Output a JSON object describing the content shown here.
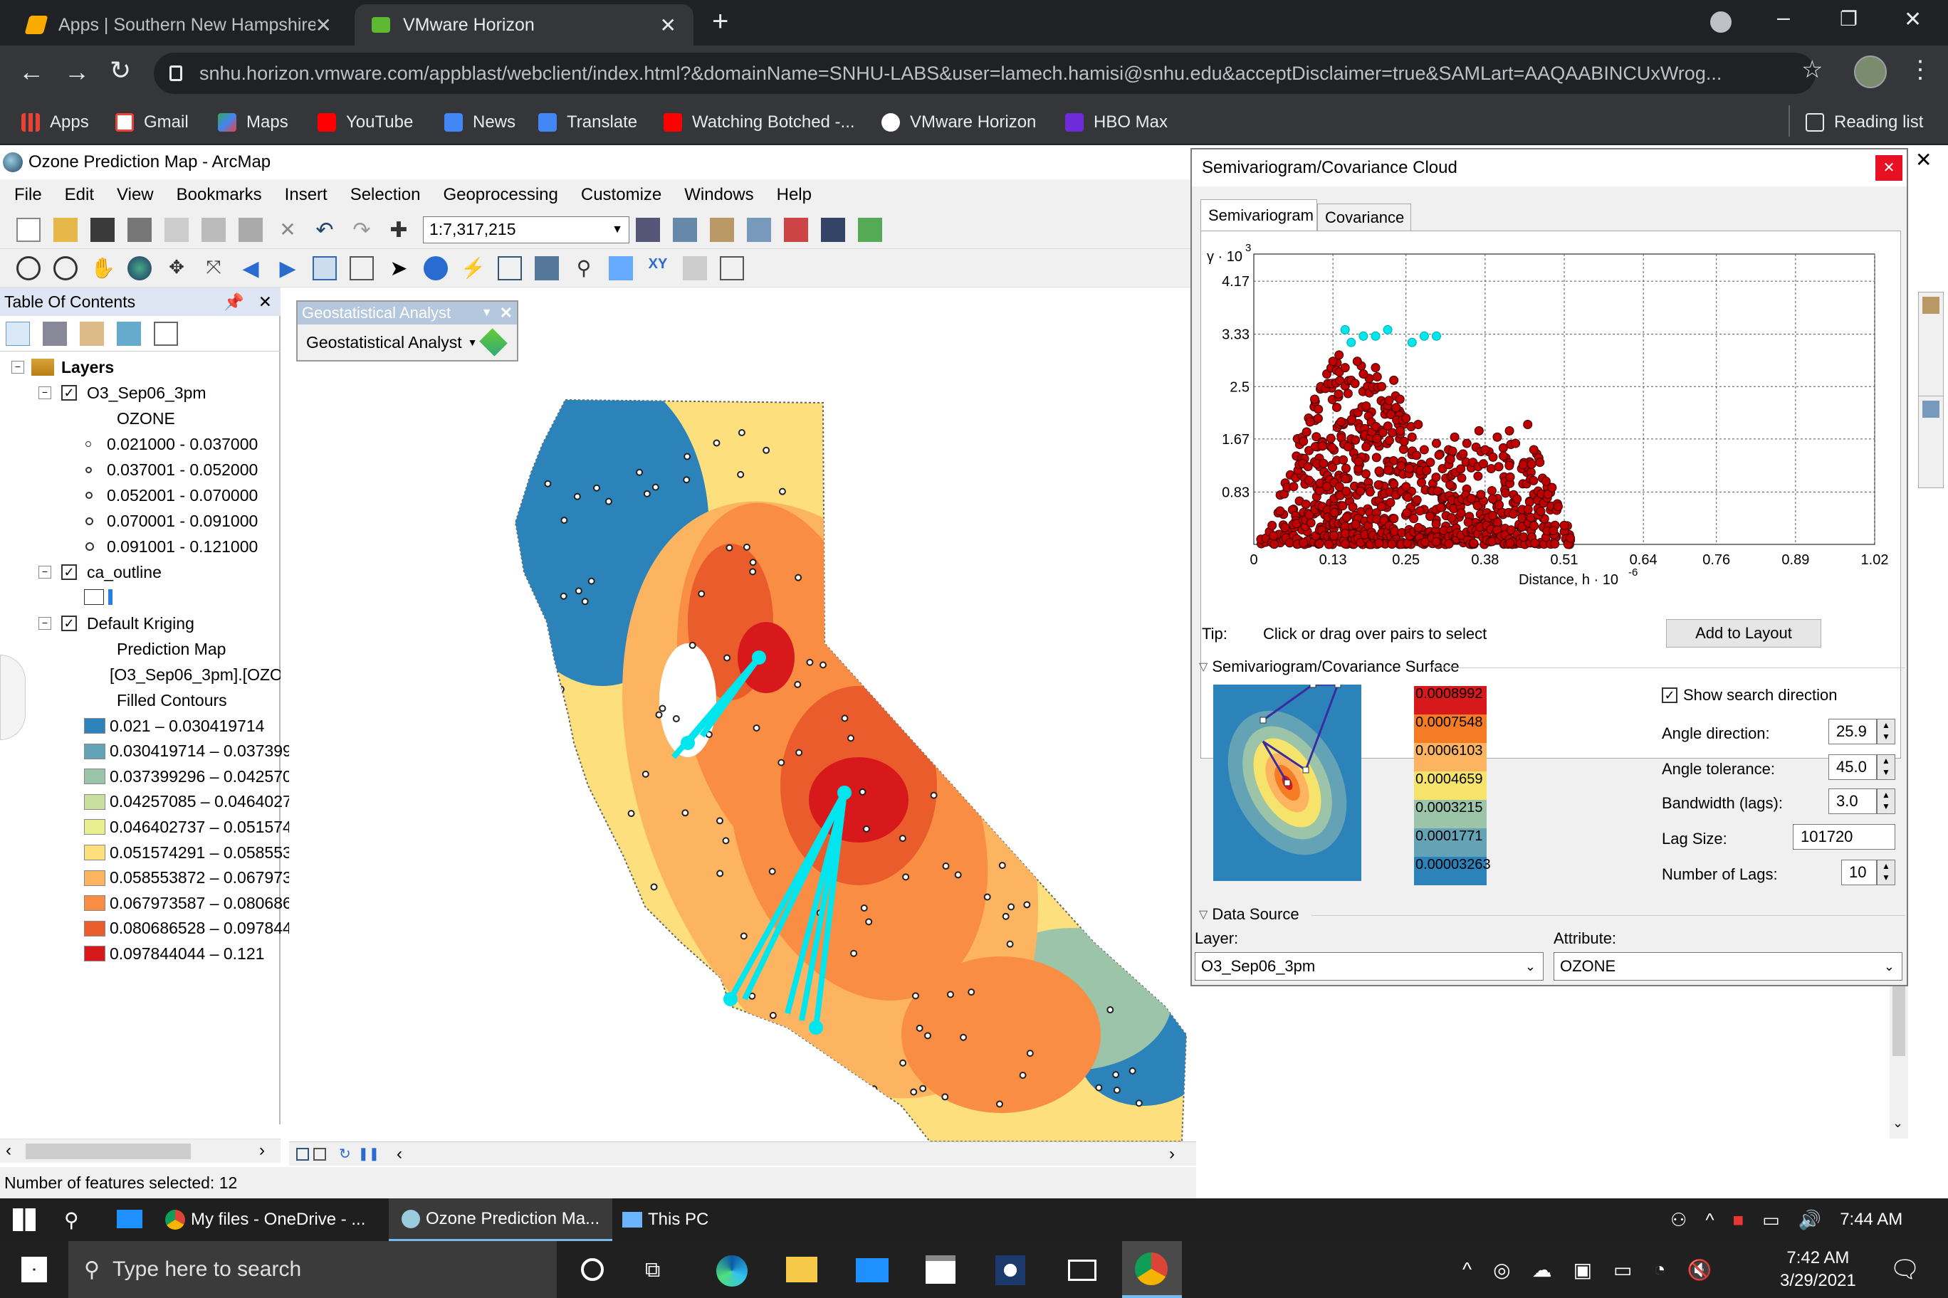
{
  "browser": {
    "tabs": [
      {
        "title": "Apps | Southern New Hampshire"
      },
      {
        "title": "VMware Horizon"
      }
    ],
    "url": "snhu.horizon.vmware.com/appblast/webclient/index.html?&domainName=SNHU-LABS&user=lamech.hamisi@snhu.edu&acceptDisclaimer=true&SAMLart=AAQAABINCUxWrog...",
    "bookmarks": [
      "Apps",
      "Gmail",
      "Maps",
      "YouTube",
      "News",
      "Translate",
      "Watching Botched -...",
      "VMware Horizon",
      "HBO Max"
    ],
    "reading_list": "Reading list"
  },
  "arcmap": {
    "title": "Ozone Prediction Map - ArcMap",
    "menus": [
      "File",
      "Edit",
      "View",
      "Bookmarks",
      "Insert",
      "Selection",
      "Geoprocessing",
      "Customize",
      "Windows",
      "Help"
    ],
    "scale": "1:7,317,215",
    "geo_toolbar_title": "Geostatistical Analyst",
    "geo_toolbar_button": "Geostatistical Analyst",
    "toc": {
      "title": "Table Of Contents",
      "layers_label": "Layers",
      "layer1": "O3_Sep06_3pm",
      "layer1_field": "OZONE",
      "layer1_classes": [
        "0.021000 - 0.037000",
        "0.037001 - 0.052000",
        "0.052001 - 0.070000",
        "0.070001 - 0.091000",
        "0.091001 - 0.121000"
      ],
      "layer2": "ca_outline",
      "layer3": "Default Kriging",
      "layer3_sub1": "Prediction Map",
      "layer3_sub2": "[O3_Sep06_3pm].[OZO",
      "layer3_sub3": "Filled Contours",
      "contours": [
        {
          "label": "0.021 – 0.030419714",
          "color": "#2b83ba"
        },
        {
          "label": "0.030419714 – 0.037399",
          "color": "#64a3b5"
        },
        {
          "label": "0.037399296 – 0.042570",
          "color": "#9cc4a8"
        },
        {
          "label": "0.04257085 – 0.0464027",
          "color": "#c7df9f"
        },
        {
          "label": "0.046402737 – 0.051574",
          "color": "#e9ee8e"
        },
        {
          "label": "0.051574291 – 0.058553",
          "color": "#fde07d"
        },
        {
          "label": "0.058553872 – 0.067973",
          "color": "#fdb460"
        },
        {
          "label": "0.067973587 – 0.080686",
          "color": "#f88d43"
        },
        {
          "label": "0.080686528 – 0.097844",
          "color": "#ea5c2b"
        },
        {
          "label": "0.097844044 – 0.121",
          "color": "#d7191c"
        }
      ]
    },
    "status": "Number of features selected: 12"
  },
  "semivariogram": {
    "title": "Semivariogram/Covariance Cloud",
    "tabs": [
      "Semivariogram",
      "Covariance"
    ],
    "tip_label": "Tip:",
    "tip_text": "Click or drag over pairs to select",
    "add_to_layout": "Add to Layout",
    "surface_section": "Semivariogram/Covariance Surface",
    "surface_legend": [
      "0.0008992",
      "0.0007548",
      "0.0006103",
      "0.0004659",
      "0.0003215",
      "0.0001771",
      "0.00003263"
    ],
    "show_search_direction": "Show search direction",
    "angle_direction_label": "Angle direction:",
    "angle_direction": "25.9",
    "angle_tolerance_label": "Angle tolerance:",
    "angle_tolerance": "45.0",
    "bandwidth_label": "Bandwidth (lags):",
    "bandwidth": "3.0",
    "lag_size_label": "Lag Size:",
    "lag_size": "101720",
    "num_lags_label": "Number of Lags:",
    "num_lags": "10",
    "data_source": "Data Source",
    "layer_label": "Layer:",
    "layer_value": "O3_Sep06_3pm",
    "attribute_label": "Attribute:",
    "attribute_value": "OZONE"
  },
  "chart_data": {
    "type": "scatter",
    "title": "",
    "xlabel": "Distance, h · 10",
    "xlabel_exponent": "-6",
    "ylabel": "γ · 10",
    "ylabel_exponent": "3",
    "xlim": [
      0,
      1.02
    ],
    "ylim": [
      0,
      4.6
    ],
    "xticks": [
      "0",
      "0.13",
      "0.25",
      "0.38",
      "0.51",
      "0.64",
      "0.76",
      "0.89",
      "1.02"
    ],
    "yticks": [
      "0.83",
      "1.67",
      "2.5",
      "3.33",
      "4.17"
    ],
    "grid": true,
    "series": [
      {
        "color": "#c00000",
        "points": [
          [
            0.02,
            0.1
          ],
          [
            0.03,
            0.3
          ],
          [
            0.04,
            0.5
          ],
          [
            0.05,
            0.8
          ],
          [
            0.06,
            1.1
          ],
          [
            0.07,
            1.4
          ],
          [
            0.08,
            1.7
          ],
          [
            0.09,
            2.0
          ],
          [
            0.1,
            2.3
          ],
          [
            0.11,
            2.5
          ],
          [
            0.12,
            2.7
          ],
          [
            0.13,
            2.9
          ],
          [
            0.14,
            3.0
          ],
          [
            0.15,
            2.8
          ],
          [
            0.16,
            2.6
          ],
          [
            0.17,
            2.9
          ],
          [
            0.18,
            2.7
          ],
          [
            0.19,
            2.4
          ],
          [
            0.2,
            2.8
          ],
          [
            0.21,
            2.5
          ],
          [
            0.22,
            2.2
          ],
          [
            0.23,
            2.6
          ],
          [
            0.24,
            2.3
          ],
          [
            0.25,
            2.0
          ],
          [
            0.26,
            1.7
          ],
          [
            0.27,
            1.9
          ],
          [
            0.28,
            1.5
          ],
          [
            0.29,
            1.3
          ],
          [
            0.3,
            1.6
          ],
          [
            0.31,
            1.2
          ],
          [
            0.32,
            1.5
          ],
          [
            0.33,
            1.7
          ],
          [
            0.34,
            1.4
          ],
          [
            0.35,
            1.6
          ],
          [
            0.36,
            1.3
          ],
          [
            0.37,
            1.8
          ],
          [
            0.38,
            1.5
          ],
          [
            0.39,
            1.2
          ],
          [
            0.4,
            1.7
          ],
          [
            0.41,
            1.4
          ],
          [
            0.42,
            1.8
          ],
          [
            0.43,
            1.6
          ],
          [
            0.44,
            1.2
          ],
          [
            0.45,
            1.9
          ],
          [
            0.46,
            1.5
          ],
          [
            0.47,
            1.3
          ],
          [
            0.48,
            1.0
          ],
          [
            0.49,
            0.9
          ],
          [
            0.5,
            0.6
          ],
          [
            0.51,
            0.3
          ],
          [
            0.52,
            0.1
          ]
        ]
      },
      {
        "color": "#00e5ee",
        "points": [
          [
            0.15,
            3.4
          ],
          [
            0.16,
            3.2
          ],
          [
            0.18,
            3.3
          ],
          [
            0.2,
            3.3
          ],
          [
            0.22,
            3.4
          ],
          [
            0.26,
            3.2
          ],
          [
            0.28,
            3.3
          ],
          [
            0.3,
            3.3
          ]
        ]
      }
    ]
  }
}
